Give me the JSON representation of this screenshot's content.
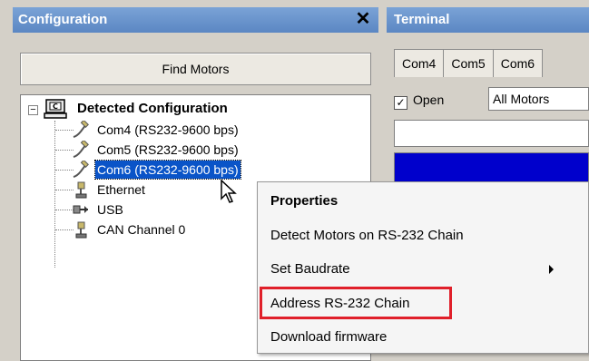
{
  "config_panel": {
    "title": "Configuration",
    "close_glyph": "✕",
    "find_button": "Find Motors",
    "tree": {
      "root_expander": "−",
      "root_label": "Detected Configuration",
      "items": [
        {
          "label": "Com4 (RS232-9600 bps)",
          "icon": "serial-port-icon"
        },
        {
          "label": "Com5 (RS232-9600 bps)",
          "icon": "serial-port-icon"
        },
        {
          "label": "Com6 (RS232-9600 bps)",
          "icon": "serial-port-icon",
          "selected": true
        },
        {
          "label": "Ethernet",
          "icon": "ethernet-icon"
        },
        {
          "label": "USB",
          "icon": "usb-icon"
        },
        {
          "label": "CAN Channel 0",
          "icon": "can-icon"
        }
      ]
    }
  },
  "terminal_panel": {
    "title": "Terminal",
    "tabs": [
      "Com4",
      "Com5",
      "Com6"
    ],
    "open_label": "Open",
    "open_checked": true,
    "motors_select": "All Motors",
    "output_color": "#0000cc"
  },
  "context_menu": {
    "items": [
      {
        "label": "Properties",
        "bold": true
      },
      {
        "label": "Detect Motors on RS-232 Chain"
      },
      {
        "label": "Set Baudrate",
        "submenu": true
      },
      {
        "label": "Address RS-232 Chain",
        "highlighted": true
      },
      {
        "label": "Download firmware"
      }
    ]
  },
  "colors": {
    "title_bar": "#5b87c3",
    "selection": "#0a54c8",
    "highlight_box": "#e0202a"
  }
}
